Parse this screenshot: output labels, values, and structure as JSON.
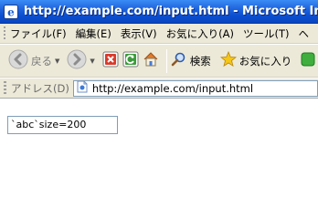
{
  "window": {
    "title": "http://example.com/input.html - Microsoft Internet Explorer"
  },
  "menu": {
    "items": [
      "ファイル(F)",
      "編集(E)",
      "表示(V)",
      "お気に入り(A)",
      "ツール(T)",
      "ヘ"
    ]
  },
  "toolbar": {
    "back_label": "戻る",
    "search_label": "検索",
    "favorites_label": "お気に入り"
  },
  "address": {
    "label": "アドレス(D)",
    "url": "http://example.com/input.html"
  },
  "page": {
    "input_value": "`abc`size=200"
  }
}
